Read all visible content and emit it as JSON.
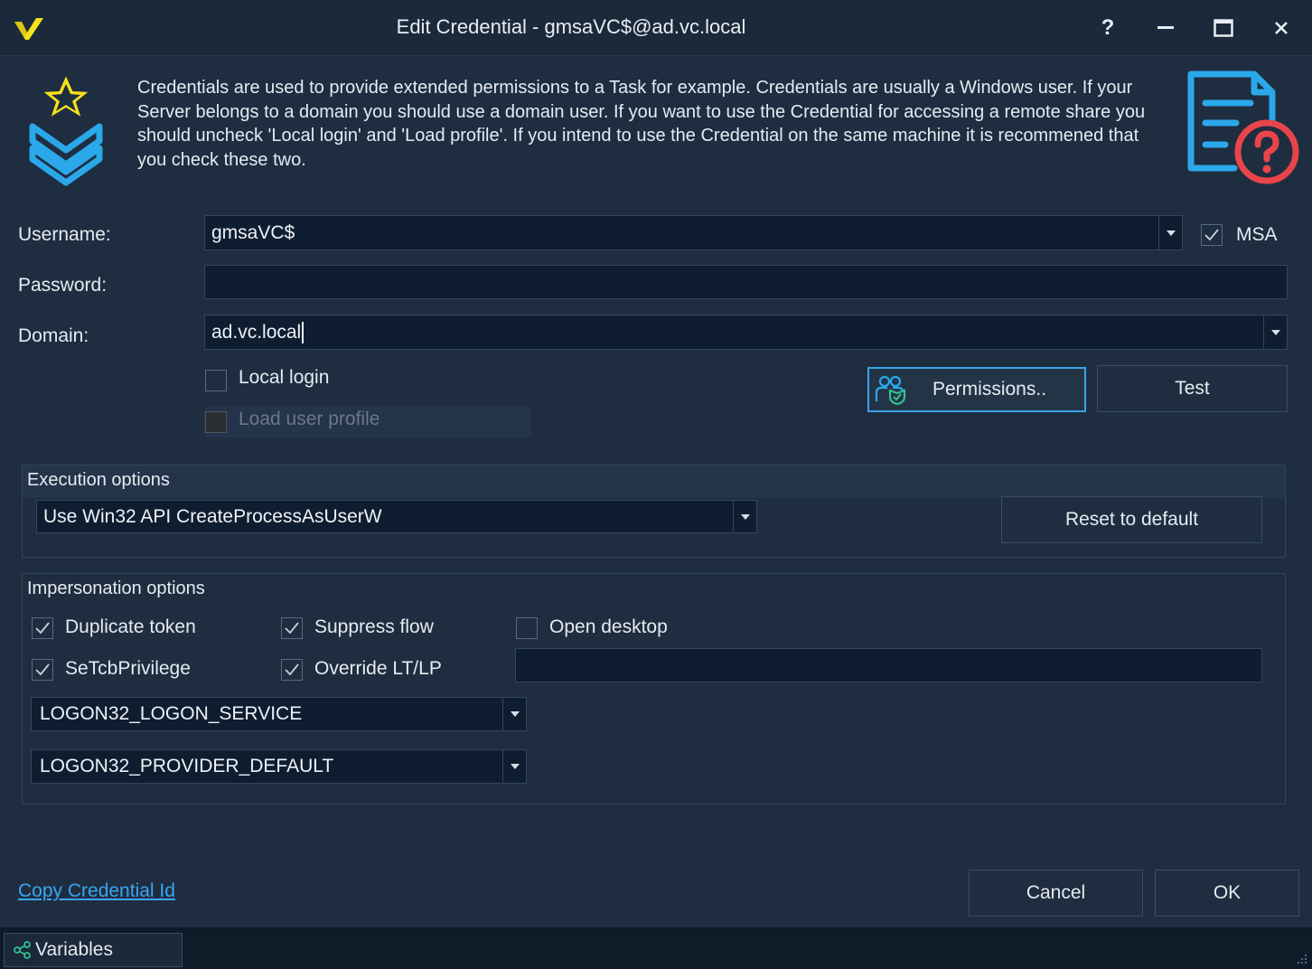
{
  "window": {
    "title": "Edit Credential - gmsaVC$@ad.vc.local",
    "help_label": "?",
    "minimize_label": "–",
    "close_label": "✕"
  },
  "info": {
    "text": "Credentials are used to provide extended permissions to a Task for example. Credentials are usually a Windows user. If your Server belongs to a domain you should use a domain user. If you want to use the Credential for accessing a remote share you should uncheck 'Local login' and 'Load profile'. If you intend to use the Credential on the same machine it is recommened that you check these two."
  },
  "form": {
    "username_label": "Username:",
    "username_value": "gmsaVC$",
    "msa_label": "MSA",
    "msa_checked": true,
    "password_label": "Password:",
    "password_value": "",
    "domain_label": "Domain:",
    "domain_value": "ad.vc.local",
    "local_login_label": "Local login",
    "local_login_checked": false,
    "load_profile_label": "Load user profile",
    "load_profile_checked": false,
    "permissions_label": "Permissions..",
    "test_label": "Test"
  },
  "execution": {
    "title": "Execution options",
    "selected": "Use Win32 API CreateProcessAsUserW",
    "reset_label": "Reset to default"
  },
  "impersonation": {
    "title": "Impersonation options",
    "duplicate_token_label": "Duplicate token",
    "duplicate_token_checked": true,
    "suppress_flow_label": "Suppress flow",
    "suppress_flow_checked": true,
    "open_desktop_label": "Open desktop",
    "open_desktop_checked": false,
    "setcb_label": "SeTcbPrivilege",
    "setcb_checked": true,
    "override_label": "Override LT/LP",
    "override_checked": true,
    "desktop_value": "",
    "logon_type": "LOGON32_LOGON_SERVICE",
    "logon_provider": "LOGON32_PROVIDER_DEFAULT"
  },
  "footer": {
    "copy_id_label": "Copy Credential Id",
    "cancel_label": "Cancel",
    "ok_label": "OK"
  },
  "statusbar": {
    "variables_label": "Variables"
  },
  "colors": {
    "background": "#1f2d40",
    "accent": "#39a4e6",
    "link": "#3aa6f0",
    "field": "#0f1d31",
    "warning_red": "#e8454a",
    "star_yellow": "#f5e21b"
  }
}
